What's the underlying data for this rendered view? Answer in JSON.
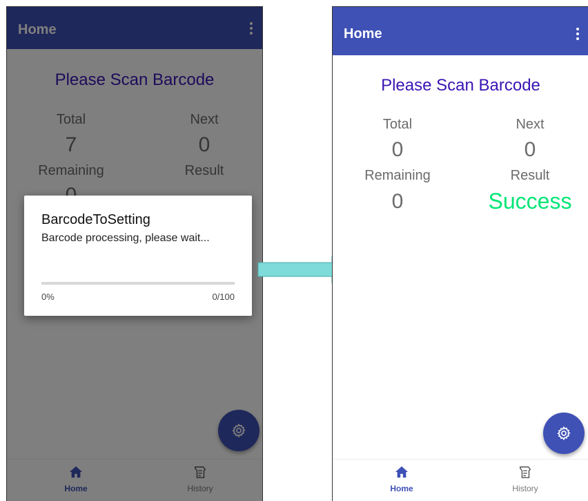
{
  "colors": {
    "primary": "#3f51b5",
    "heading": "#3a14b4",
    "success": "#00e676",
    "arrow": "#7fdbda"
  },
  "left": {
    "appbar": {
      "title": "Home"
    },
    "heading": "Please Scan Barcode",
    "stats": {
      "total_label": "Total",
      "total_value": "7",
      "next_label": "Next",
      "next_value": "0",
      "remaining_label": "Remaining",
      "remaining_value": "0",
      "result_label": "Result"
    },
    "dialog": {
      "title": "BarcodeToSetting",
      "message": "Barcode processing, please wait...",
      "progress_percent": "0%",
      "progress_count": "0/100",
      "progress": 0
    },
    "nav": {
      "home_label": "Home",
      "history_label": "History"
    },
    "fab_icon": "settings-gear-icon"
  },
  "right": {
    "appbar": {
      "title": "Home"
    },
    "heading": "Please Scan Barcode",
    "stats": {
      "total_label": "Total",
      "total_value": "0",
      "next_label": "Next",
      "next_value": "0",
      "remaining_label": "Remaining",
      "remaining_value": "0",
      "result_label": "Result",
      "result_value": "Success"
    },
    "nav": {
      "home_label": "Home",
      "history_label": "History"
    },
    "fab_icon": "settings-gear-icon"
  }
}
